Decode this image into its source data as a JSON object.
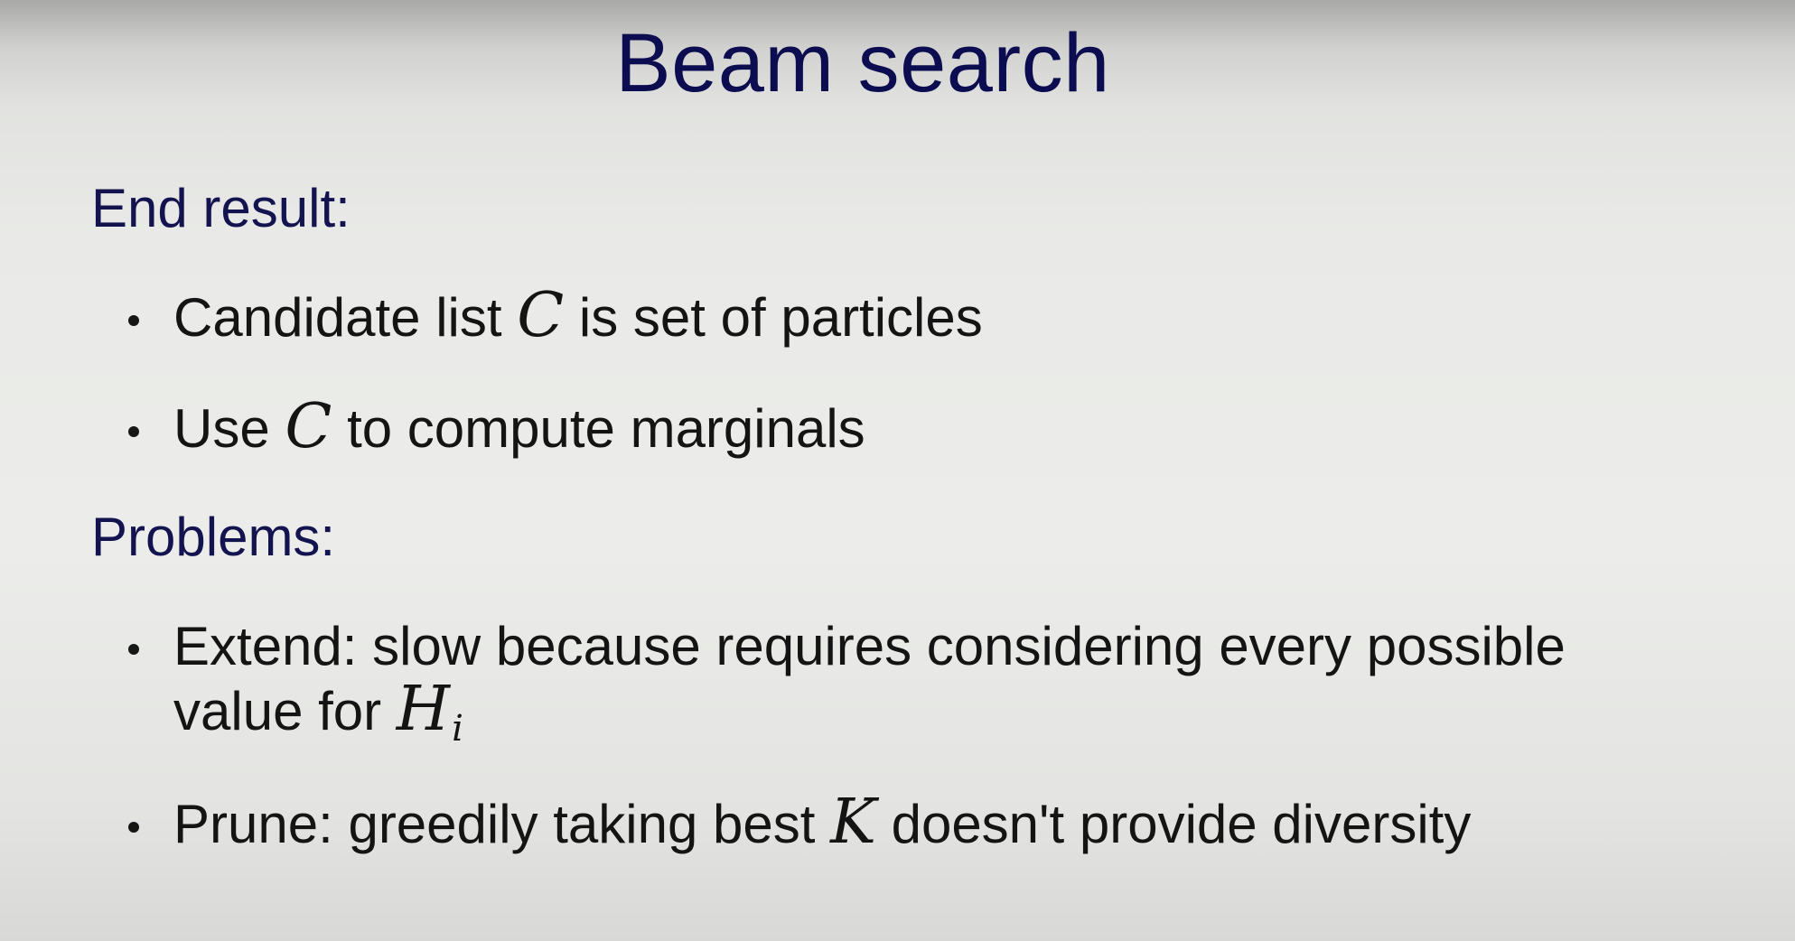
{
  "slide": {
    "title": "Beam search",
    "sections": [
      {
        "heading": "End result:",
        "items": [
          {
            "before": "Candidate list ",
            "math": "C",
            "after": " is set of particles"
          },
          {
            "before": "Use ",
            "math": "C",
            "after": " to compute marginals"
          }
        ]
      },
      {
        "heading": "Problems:",
        "items": [
          {
            "line1": "Extend: slow because requires considering every possible",
            "line2_before": "value for ",
            "math": "H",
            "math_sub": "i"
          },
          {
            "before": "Prune: greedily taking best ",
            "math": "K",
            "after": " doesn't provide diversity"
          }
        ]
      }
    ]
  }
}
